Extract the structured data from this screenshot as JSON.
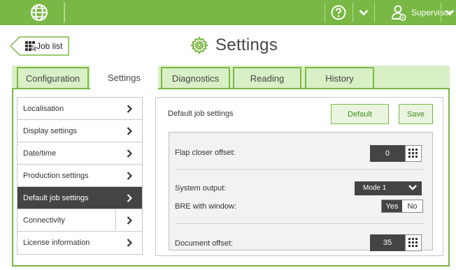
{
  "topbar": {
    "icons": [
      "globe-icon",
      "help-icon",
      "chevron-down-icon",
      "user-icon",
      "chevron-down-icon"
    ],
    "role": "Supervisor",
    "accent": "#79b845"
  },
  "header": {
    "back_label": "Job list",
    "title": "Settings"
  },
  "tabs": [
    {
      "label": "Configuration",
      "active": false
    },
    {
      "label": "Settings",
      "active": true
    },
    {
      "label": "Diagnostics",
      "active": false
    },
    {
      "label": "Reading",
      "active": false
    },
    {
      "label": "History",
      "active": false
    }
  ],
  "menu": [
    {
      "label": "Localisation",
      "active": false
    },
    {
      "label": "Display settings",
      "active": false
    },
    {
      "label": "Date/time",
      "active": false
    },
    {
      "label": "Production settings",
      "active": false
    },
    {
      "label": "Default job settings",
      "active": true
    },
    {
      "label": "Connectivity",
      "active": false
    },
    {
      "label": "License information",
      "active": false
    }
  ],
  "panel": {
    "title": "Default job settings",
    "default_label": "Default",
    "save_label": "Save",
    "fields": {
      "flap_closer_offset_label": "Flap closer offset:",
      "flap_closer_offset_value": "0",
      "system_output_label": "System output:",
      "system_output_value": "Mode 1",
      "bre_label": "BRE with window:",
      "bre_yes": "Yes",
      "bre_no": "No",
      "bre_selected": "Yes",
      "document_offset_label": "Document offset:",
      "document_offset_value": "35"
    }
  }
}
